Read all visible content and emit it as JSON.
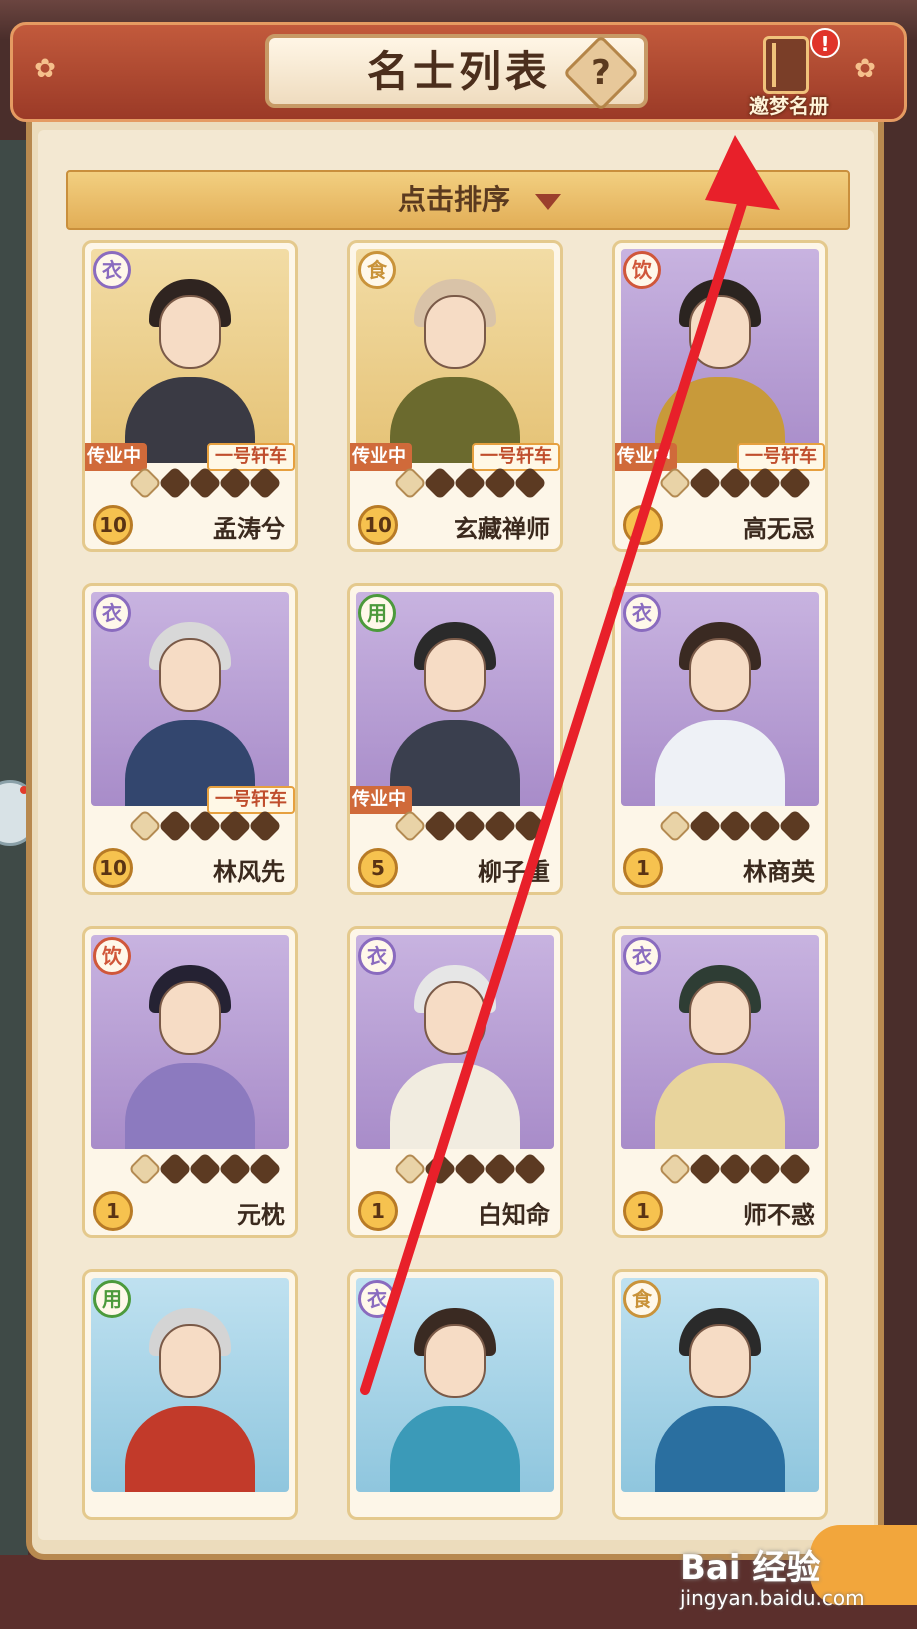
{
  "header": {
    "title": "名士列表",
    "help_glyph": "?",
    "roster_label": "邀梦名册",
    "alert_glyph": "!"
  },
  "sort": {
    "label": "点击排序"
  },
  "tags": {
    "pass": "传业中",
    "cart": "一号轩车"
  },
  "colors": {
    "衣": "#8a6bbf",
    "食": "#c9933a",
    "饮": "#d0573a",
    "用": "#4c9a3c"
  },
  "cards": [
    {
      "name": "孟涛兮",
      "type": "衣",
      "level": "10",
      "passing": true,
      "cart": true,
      "stars_filled": 4,
      "bg": "gold",
      "hair": "#2f2420",
      "robe": "#3a3a44"
    },
    {
      "name": "玄藏禅师",
      "type": "食",
      "level": "10",
      "passing": true,
      "cart": true,
      "stars_filled": 4,
      "bg": "gold",
      "hair": "#d9c3a8",
      "robe": "#6b6a2e"
    },
    {
      "name": "高无忌",
      "type": "饮",
      "level": "",
      "passing": true,
      "cart": true,
      "stars_filled": 4,
      "bg": "purple",
      "hair": "#2b2420",
      "robe": "#c89a3a"
    },
    {
      "name": "林风先",
      "type": "衣",
      "level": "10",
      "passing": false,
      "cart": true,
      "stars_filled": 4,
      "bg": "purple",
      "hair": "#d8d8d8",
      "robe": "#33466e"
    },
    {
      "name": "柳子重",
      "type": "用",
      "level": "5",
      "passing": true,
      "cart": false,
      "stars_filled": 4,
      "bg": "purple",
      "hair": "#2a2a2a",
      "robe": "#3a3f4e"
    },
    {
      "name": "林商英",
      "type": "衣",
      "level": "1",
      "passing": false,
      "cart": false,
      "stars_filled": 4,
      "bg": "purple",
      "hair": "#3a2a22",
      "robe": "#eef1f6"
    },
    {
      "name": "元枕",
      "type": "饮",
      "level": "1",
      "passing": false,
      "cart": false,
      "stars_filled": 4,
      "bg": "purple",
      "hair": "#252233",
      "robe": "#8c7abf"
    },
    {
      "name": "白知命",
      "type": "衣",
      "level": "1",
      "passing": false,
      "cart": false,
      "stars_filled": 4,
      "bg": "purple",
      "hair": "#e6e6e6",
      "robe": "#f1ece0"
    },
    {
      "name": "师不惑",
      "type": "衣",
      "level": "1",
      "passing": false,
      "cart": false,
      "stars_filled": 4,
      "bg": "purple",
      "hair": "#2e3d34",
      "robe": "#e8d49c"
    },
    {
      "name": "",
      "type": "用",
      "level": "",
      "passing": false,
      "cart": false,
      "stars_filled": 4,
      "bg": "blue",
      "hair": "#d4d4d4",
      "robe": "#c23a2a"
    },
    {
      "name": "",
      "type": "衣",
      "level": "",
      "passing": false,
      "cart": false,
      "stars_filled": 4,
      "bg": "blue",
      "hair": "#3a2a22",
      "robe": "#3b9ab8"
    },
    {
      "name": "",
      "type": "食",
      "level": "",
      "passing": false,
      "cart": false,
      "stars_filled": 4,
      "bg": "blue",
      "hair": "#2a2a2a",
      "robe": "#2a6fa0"
    }
  ],
  "watermark": {
    "main": "Bai 经验",
    "sub": "jingyan.baidu.com"
  }
}
